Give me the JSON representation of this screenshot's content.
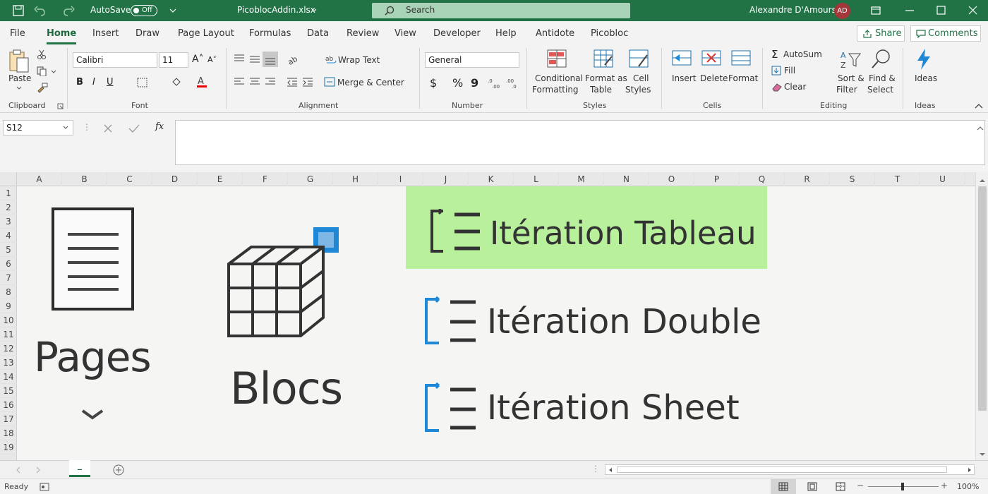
{
  "title_bar": {
    "autosave_label": "AutoSave",
    "autosave_state": "Off",
    "file_name": "PicoblocAddin.xlsx",
    "search_placeholder": "Search",
    "user_name": "Alexandre D'Amours",
    "user_initials": "AD"
  },
  "tabs": [
    "File",
    "Home",
    "Insert",
    "Draw",
    "Page Layout",
    "Formulas",
    "Data",
    "Review",
    "View",
    "Developer",
    "Help",
    "Antidote",
    "Picobloc"
  ],
  "active_tab": "Home",
  "share_label": "Share",
  "comments_label": "Comments",
  "ribbon": {
    "clipboard": {
      "group": "Clipboard",
      "paste": "Paste"
    },
    "font": {
      "group": "Font",
      "font_name": "Calibri",
      "font_size": "11",
      "bold": "B",
      "italic": "I",
      "underline": "U"
    },
    "alignment": {
      "group": "Alignment",
      "wrap_text": "Wrap Text",
      "merge_center": "Merge & Center"
    },
    "number": {
      "group": "Number",
      "format": "General",
      "currency": "$",
      "percent": "%",
      "comma": "9"
    },
    "styles": {
      "group": "Styles",
      "conditional_1": "Conditional",
      "conditional_2": "Formatting",
      "format_table_1": "Format as",
      "format_table_2": "Table",
      "cell_styles_1": "Cell",
      "cell_styles_2": "Styles"
    },
    "cells": {
      "group": "Cells",
      "insert": "Insert",
      "delete": "Delete",
      "format": "Format"
    },
    "editing": {
      "group": "Editing",
      "autosum": "AutoSum",
      "fill": "Fill",
      "clear": "Clear",
      "sort_1": "Sort &",
      "sort_2": "Filter",
      "find_1": "Find &",
      "find_2": "Select"
    },
    "ideas": {
      "group": "Ideas",
      "ideas": "Ideas"
    }
  },
  "formula_bar": {
    "name_box": "S12",
    "fx": "fx",
    "value": ""
  },
  "columns": [
    "A",
    "B",
    "C",
    "D",
    "E",
    "F",
    "G",
    "H",
    "I",
    "J",
    "K",
    "L",
    "M",
    "N",
    "O",
    "P",
    "Q",
    "R",
    "S",
    "T",
    "U"
  ],
  "rows": [
    "1",
    "2",
    "3",
    "4",
    "5",
    "6",
    "7",
    "8",
    "9",
    "10",
    "11",
    "12",
    "13",
    "14",
    "15",
    "16",
    "17",
    "18",
    "19"
  ],
  "content": {
    "pages_label": "Pages",
    "blocs_label": "Blocs",
    "iterations": [
      "Itération Tableau",
      "Itération Double",
      "Itération Sheet"
    ],
    "highlight_color": "#b8f09c",
    "accent_blue": "#1e88d6"
  },
  "sheet_tab": "_",
  "status": {
    "ready": "Ready",
    "zoom": "100%"
  }
}
